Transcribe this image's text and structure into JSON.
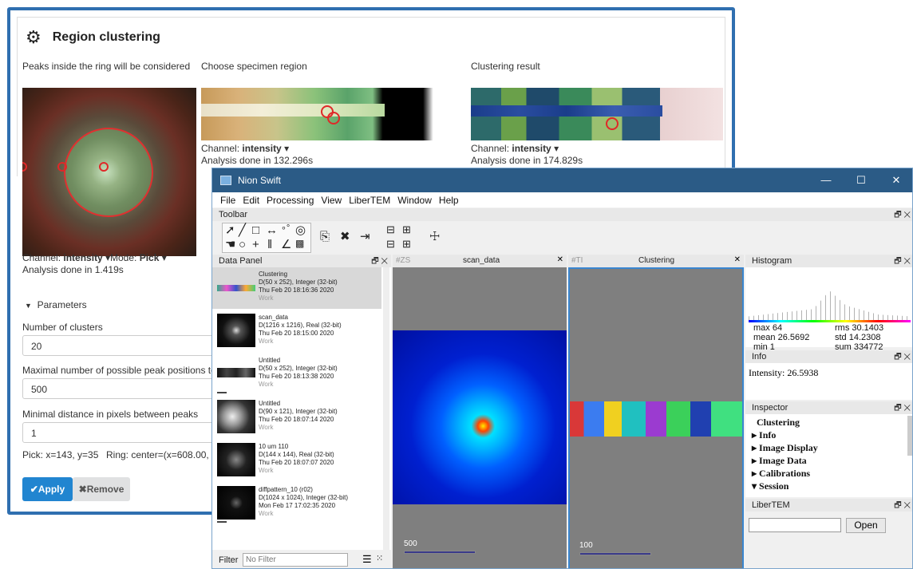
{
  "web": {
    "title": "Region clustering",
    "col1_label": "Peaks inside the ring will be considered",
    "col2_label": "Choose specimen region",
    "col3_label": "Clustering result",
    "channel_prefix": "Channel:",
    "channel_value": "intensity",
    "mode_prefix": "Mode:",
    "mode_value": "Pick",
    "analysis1": "Analysis done in 1.419s",
    "analysis2": "Analysis done in 132.296s",
    "analysis3": "Analysis done in 174.829s",
    "params_toggle": "Parameters",
    "num_clusters_label": "Number of clusters",
    "num_clusters_value": "20",
    "max_peaks_label": "Maximal number of possible peak positions to dete",
    "max_peaks_value": "500",
    "min_dist_label": "Minimal distance in pixels between peaks",
    "min_dist_value": "1",
    "pick_info": "Pick: x=143, y=35",
    "ring_info": "Ring: center=(x=608.00, y=",
    "apply_label": "Apply",
    "remove_label": "Remove"
  },
  "nion": {
    "window_title": "Nion Swift",
    "menu": [
      "File",
      "Edit",
      "Processing",
      "View",
      "LiberTEM",
      "Window",
      "Help"
    ],
    "toolbar_title": "Toolbar",
    "data_panel_title": "Data Panel",
    "items": [
      {
        "name": "Clustering",
        "dims": "D(50 x 252), Integer (32-bit)",
        "date": "Thu Feb 20 18:16:36 2020",
        "tag": "Work"
      },
      {
        "name": "scan_data",
        "dims": "D(1216 x 1216), Real (32-bit)",
        "date": "Thu Feb 20 18:15:00 2020",
        "tag": "Work"
      },
      {
        "name": "Untitled",
        "dims": "D(50 x 252), Integer (32-bit)",
        "date": "Thu Feb 20 18:13:38 2020",
        "tag": "Work"
      },
      {
        "name": "Untitled",
        "dims": "D(90 x 121), Integer (32-bit)",
        "date": "Thu Feb 20 18:07:14 2020",
        "tag": "Work"
      },
      {
        "name": "10 um 110",
        "dims": "D(144 x 144), Real (32-bit)",
        "date": "Thu Feb 20 18:07:07 2020",
        "tag": "Work"
      },
      {
        "name": "diffpattern_10 (r02)",
        "dims": "D(1024 x 1024), Integer (32-bit)",
        "date": "Mon Feb 17 17:02:35 2020",
        "tag": "Work"
      }
    ],
    "filter_label": "Filter",
    "filter_placeholder": "No Filter",
    "display1_id": "#ZS",
    "display1_title": "scan_data",
    "display1_scale": "500",
    "display2_id": "#TI",
    "display2_title": "Clustering",
    "display2_scale": "100",
    "histogram_title": "Histogram",
    "hist_max": "max 64",
    "hist_mean": "mean 26.5692",
    "hist_min": "min 1",
    "hist_rms": "rms 30.1403",
    "hist_std": "std 14.2308",
    "hist_sum": "sum 334772",
    "info_title": "Info",
    "info_text": "Intensity: 26.5938",
    "inspector_title": "Inspector",
    "inspector_name": "Clustering",
    "inspector_sections": [
      "Info",
      "Image Display",
      "Image Data",
      "Calibrations",
      "Session"
    ],
    "libertem_title": "LiberTEM",
    "open_label": "Open",
    "close_glyph": "✕",
    "float_glyph": "🗗"
  }
}
